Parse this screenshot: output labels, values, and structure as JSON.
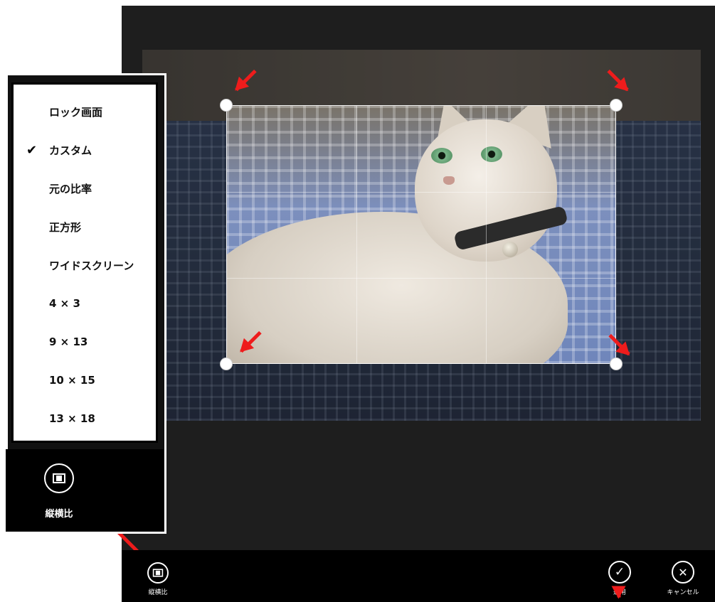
{
  "aspect_menu": {
    "items": [
      {
        "label": "ロック画面",
        "checked": false
      },
      {
        "label": "カスタム",
        "checked": true
      },
      {
        "label": "元の比率",
        "checked": false
      },
      {
        "label": "正方形",
        "checked": false
      },
      {
        "label": "ワイドスクリーン",
        "checked": false
      },
      {
        "label": "4 × 3",
        "checked": false
      },
      {
        "label": "9 × 13",
        "checked": false
      },
      {
        "label": "10 × 15",
        "checked": false
      },
      {
        "label": "13 × 18",
        "checked": false
      }
    ],
    "check_glyph": "✔",
    "toggle_label": "縦横比"
  },
  "app_bar": {
    "aspect_label": "縦横比",
    "apply_label": "適用",
    "cancel_label": "キャンセル"
  },
  "icons": {
    "check": "✓",
    "close": "✕"
  },
  "colors": {
    "background": "#1e1e1e",
    "annotation": "#ee1c1c",
    "menu_bg": "#ffffff",
    "app_bar": "#000000"
  }
}
